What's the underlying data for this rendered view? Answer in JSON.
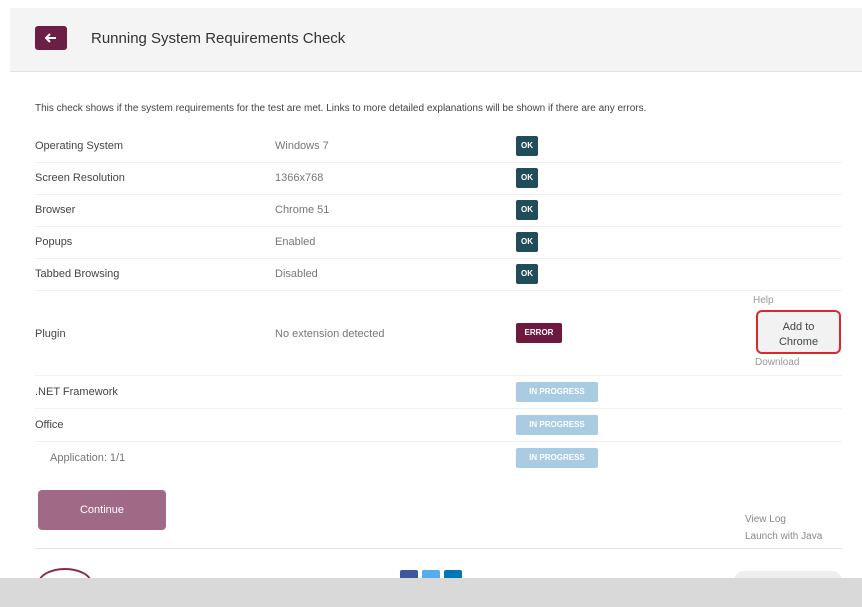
{
  "header": {
    "title": "Running System Requirements Check",
    "back_icon": "arrow-left-icon"
  },
  "intro": "This check shows if the system requirements for the test are met. Links to more detailed explanations will be shown if there are any errors.",
  "rows": [
    {
      "label": "Operating System",
      "value": "Windows 7",
      "status": "OK"
    },
    {
      "label": "Screen Resolution",
      "value": "1366x768",
      "status": "OK"
    },
    {
      "label": "Browser",
      "value": "Chrome 51",
      "status": "OK"
    },
    {
      "label": "Popups",
      "value": "Enabled",
      "status": "OK"
    },
    {
      "label": "Tabbed Browsing",
      "value": "Disabled",
      "status": "OK"
    },
    {
      "label": "Plugin",
      "value": "No extension detected",
      "status": "ERROR"
    },
    {
      "label": ".NET Framework",
      "value": "",
      "status": "IN PROGRESS"
    },
    {
      "label": "Office",
      "value": "",
      "status": "IN PROGRESS"
    },
    {
      "label": "Application: 1/1",
      "value": "",
      "status": "IN PROGRESS"
    }
  ],
  "plugin_actions": {
    "help": "Help",
    "add_line1": "Add to",
    "add_line2": "Chrome",
    "download": "Download"
  },
  "footer": {
    "continue": "Continue",
    "view_log": "View Log",
    "launch_java": "Launch with Java"
  },
  "colors": {
    "ok": "#1f4e5a",
    "error": "#6e1a3e",
    "in_progress": "#a9cce2",
    "accent": "#6b1f45",
    "highlight": "#d9282f"
  }
}
